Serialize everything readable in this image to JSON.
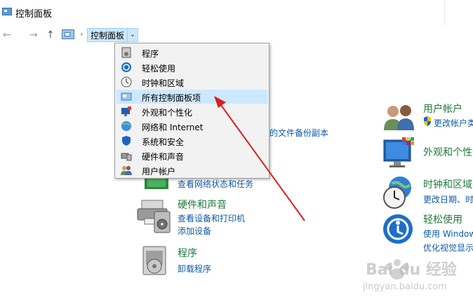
{
  "window": {
    "title": "控制面板"
  },
  "nav": {
    "back": "←",
    "forward": "→",
    "up": "↑",
    "breadcrumb": "控制面板",
    "separator": "›",
    "dropdown": "⌄"
  },
  "dropdown_items": [
    {
      "label": "程序",
      "icon": "program-icon"
    },
    {
      "label": "轻松使用",
      "icon": "ease-of-access-icon"
    },
    {
      "label": "时钟和区域",
      "icon": "clock-icon"
    },
    {
      "label": "所有控制面板项",
      "icon": "control-panel-icon",
      "selected": true
    },
    {
      "label": "外观和个性化",
      "icon": "appearance-icon"
    },
    {
      "label": "网络和 Internet",
      "icon": "network-icon"
    },
    {
      "label": "系统和安全",
      "icon": "security-icon"
    },
    {
      "label": "硬件和声音",
      "icon": "hardware-icon"
    },
    {
      "label": "用户帐户",
      "icon": "user-accounts-icon"
    }
  ],
  "categories_left": {
    "backup_link_fragment": "的文件备份副本",
    "network_link": "查看网络状态和任务",
    "hardware": {
      "title": "硬件和声音",
      "links": [
        "查看设备和打印机",
        "添加设备"
      ]
    },
    "programs": {
      "title": "程序",
      "links": [
        "卸载程序"
      ]
    }
  },
  "categories_right": {
    "users": {
      "title": "用户帐户",
      "link": "更改帐户类"
    },
    "appearance": {
      "title": "外观和个性化"
    },
    "clock": {
      "title": "时钟和区域",
      "link": "更改日期、时"
    },
    "ease": {
      "title": "轻松使用",
      "links": [
        "使用 Windows",
        "优化视觉显示"
      ]
    }
  },
  "watermark": {
    "text": "Bai du 经验",
    "sub": "jingyan.baidu.com"
  },
  "colors": {
    "arrow": "#d92020",
    "selection": "#cce8ff",
    "category_title": "#217a3c",
    "link": "#0e5aa7"
  }
}
